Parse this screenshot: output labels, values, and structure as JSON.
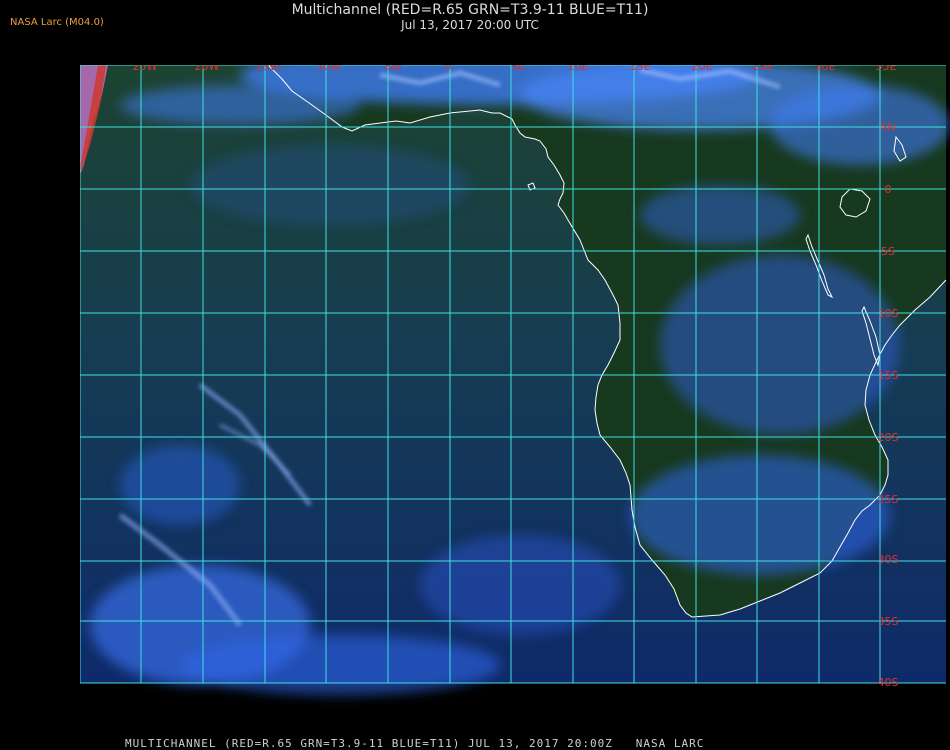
{
  "header": {
    "credit": "NASA Larc (M04.0)",
    "title": "Multichannel (RED=R.65 GRN=T3.9-11 BLUE=T11)",
    "subtitle": "Jul 13, 2017 20:00 UTC"
  },
  "map": {
    "longitude_labels": [
      "25W",
      "20W",
      "15W",
      "10W",
      "5W",
      "0",
      "5E",
      "10E",
      "15E",
      "20E",
      "25E",
      "30E",
      "35E"
    ],
    "latitude_labels": [
      "5N",
      "0",
      "5S",
      "10S",
      "15S",
      "20S",
      "25S",
      "30S",
      "35S",
      "40S"
    ],
    "colors": {
      "grid": "#3fe0e0",
      "labels": "#e03030",
      "coastline": "#ffffff",
      "ocean": "#0d2e5a",
      "land": "#1c4a22",
      "clouds": "#3a7cff"
    }
  },
  "footer": {
    "caption": "MULTICHANNEL (RED=R.65 GRN=T3.9-11 BLUE=T11) JUL 13, 2017 20:00Z   NASA LARC"
  }
}
